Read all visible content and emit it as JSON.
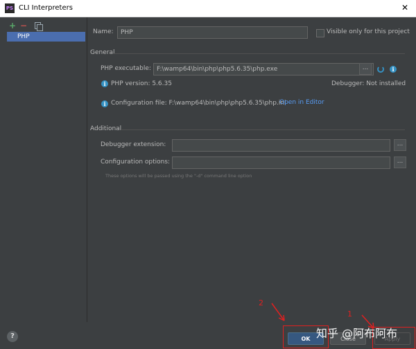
{
  "window": {
    "title": "CLI Interpreters",
    "app_icon": "PS"
  },
  "left": {
    "toolbar": {
      "add": "+",
      "remove": "−"
    },
    "items": [
      {
        "label": "PHP"
      }
    ]
  },
  "main": {
    "name_label": "Name:",
    "name_value": "PHP",
    "visible_only_label": "Visible only for this project",
    "general": {
      "title": "General",
      "executable_label": "PHP executable:",
      "executable_value": "F:\\wamp64\\bin\\php\\php5.6.35\\php.exe",
      "browse": "...",
      "version_text": "PHP version: 5.6.35",
      "debugger_text": "Debugger: Not installed",
      "config_text": "Configuration file: F:\\wamp64\\bin\\php\\php5.6.35\\php.ini",
      "open_in_editor": "Open in Editor"
    },
    "additional": {
      "title": "Additional",
      "debugger_ext_label": "Debugger extension:",
      "config_options_label": "Configuration options:",
      "browse": "...",
      "hint": "These options will be passed using the \"-d\" command line option"
    }
  },
  "buttons": {
    "help": "?",
    "ok": "OK",
    "close": "Close",
    "apply": "Apply"
  },
  "annotations": {
    "marker_1": "1",
    "marker_2": "2",
    "watermark": "知乎 @阿布阿布"
  },
  "colors": {
    "accent": "#4b6eaf",
    "link": "#589df6",
    "annotation": "#e02020"
  }
}
